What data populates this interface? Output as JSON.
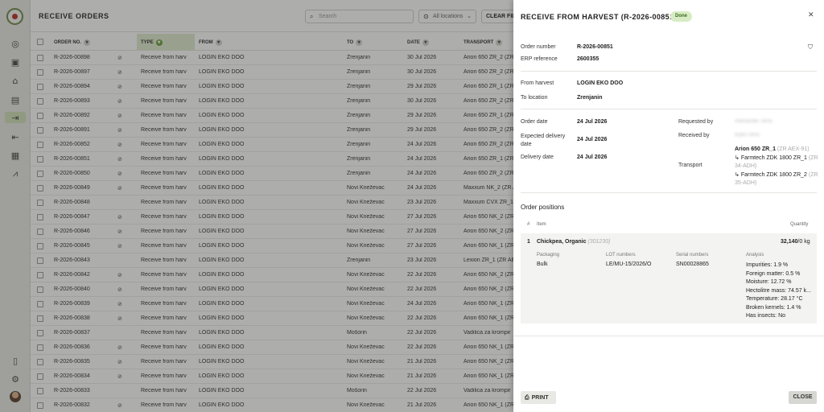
{
  "sidebar": {
    "icons": [
      "logo-icon",
      "globe-icon",
      "document-icon",
      "warehouse-icon",
      "clipboard-icon",
      "receive-icon",
      "dispatch-icon",
      "buildings-icon",
      "chart-icon"
    ],
    "bottom_icons": [
      "book-icon",
      "gear-icon",
      "avatar"
    ]
  },
  "header": {
    "title": "RECEIVE ORDERS",
    "search_placeholder": "Search",
    "location_select": "All locations",
    "clear_filters": "CLEAR FILTERS"
  },
  "table": {
    "columns": [
      "ORDER NO.",
      "TYPE",
      "FROM",
      "TO",
      "DATE",
      "TRANSPORT"
    ],
    "rows": [
      {
        "no": "R-2026-00898",
        "icon": true,
        "type": "Receive from harv",
        "from": "LOGIN EKO DOO",
        "to": "Zrenjanin",
        "date": "30 Jul 2026",
        "transport": "Arion 650 ZR_2 (ZR"
      },
      {
        "no": "R-2026-00897",
        "icon": true,
        "type": "Receive from harv",
        "from": "LOGIN EKO DOO",
        "to": "Zrenjanin",
        "date": "30 Jul 2026",
        "transport": "Arion 650 ZR_2 (ZR"
      },
      {
        "no": "R-2026-00894",
        "icon": true,
        "type": "Receive from harv",
        "from": "LOGIN EKO DOO",
        "to": "Zrenjanin",
        "date": "29 Jul 2026",
        "transport": "Arion 650 ZR_1 (ZR"
      },
      {
        "no": "R-2026-00893",
        "icon": true,
        "type": "Receive from harv",
        "from": "LOGIN EKO DOO",
        "to": "Zrenjanin",
        "date": "30 Jul 2026",
        "transport": "Arion 650 ZR_2 (ZR"
      },
      {
        "no": "R-2026-00892",
        "icon": true,
        "type": "Receive from harv",
        "from": "LOGIN EKO DOO",
        "to": "Zrenjanin",
        "date": "29 Jul 2026",
        "transport": "Arion 650 ZR_1 (ZR"
      },
      {
        "no": "R-2026-00891",
        "icon": true,
        "type": "Receive from harv",
        "from": "LOGIN EKO DOO",
        "to": "Zrenjanin",
        "date": "29 Jul 2026",
        "transport": "Arion 650 ZR_2 (ZR"
      },
      {
        "no": "R-2026-00852",
        "icon": true,
        "type": "Receive from harv",
        "from": "LOGIN EKO DOO",
        "to": "Zrenjanin",
        "date": "24 Jul 2026",
        "transport": "Arion 650 ZR_2 (ZR"
      },
      {
        "no": "R-2026-00851",
        "icon": true,
        "type": "Receive from harv",
        "from": "LOGIN EKO DOO",
        "to": "Zrenjanin",
        "date": "24 Jul 2026",
        "transport": "Arion 650 ZR_1 (ZR"
      },
      {
        "no": "R-2026-00850",
        "icon": true,
        "type": "Receive from harv",
        "from": "LOGIN EKO DOO",
        "to": "Zrenjanin",
        "date": "24 Jul 2026",
        "transport": "Arion 650 ZR_2 (ZR"
      },
      {
        "no": "R-2026-00849",
        "icon": true,
        "type": "Receive from harv",
        "from": "LOGIN EKO DOO",
        "to": "Novi Kneževac",
        "date": "24 Jul 2026",
        "transport": "Maxxum NK_2 (ZR A"
      },
      {
        "no": "R-2026-00848",
        "icon": false,
        "type": "Receive from harv",
        "from": "LOGIN EKO DOO",
        "to": "Novi Kneževac",
        "date": "23 Jul 2026",
        "transport": "Maxxum CVX ZR_1 ("
      },
      {
        "no": "R-2026-00847",
        "icon": true,
        "type": "Receive from harv",
        "from": "LOGIN EKO DOO",
        "to": "Novi Kneževac",
        "date": "27 Jul 2026",
        "transport": "Arion 650 NK_2 (ZR"
      },
      {
        "no": "R-2026-00846",
        "icon": true,
        "type": "Receive from harv",
        "from": "LOGIN EKO DOO",
        "to": "Novi Kneževac",
        "date": "27 Jul 2026",
        "transport": "Arion 650 NK_2 (ZR"
      },
      {
        "no": "R-2026-00845",
        "icon": true,
        "type": "Receive from harv",
        "from": "LOGIN EKO DOO",
        "to": "Novi Kneževac",
        "date": "27 Jul 2026",
        "transport": "Arion 650 NK_1 (ZR"
      },
      {
        "no": "R-2026-00843",
        "icon": false,
        "type": "Receive from harv",
        "from": "LOGIN EKO DOO",
        "to": "Zrenjanin",
        "date": "23 Jul 2026",
        "transport": "Lexion ZR_1 (ZR AE"
      },
      {
        "no": "R-2026-00842",
        "icon": true,
        "type": "Receive from harv",
        "from": "LOGIN EKO DOO",
        "to": "Novi Kneževac",
        "date": "22 Jul 2026",
        "transport": "Arion 650 NK_2 (ZR"
      },
      {
        "no": "R-2026-00840",
        "icon": true,
        "type": "Receive from harv",
        "from": "LOGIN EKO DOO",
        "to": "Novi Kneževac",
        "date": "22 Jul 2026",
        "transport": "Arion 650 NK_2 (ZR"
      },
      {
        "no": "R-2026-00839",
        "icon": true,
        "type": "Receive from harv",
        "from": "LOGIN EKO DOO",
        "to": "Novi Kneževac",
        "date": "24 Jul 2026",
        "transport": "Arion 650 NK_1 (ZR"
      },
      {
        "no": "R-2026-00838",
        "icon": true,
        "type": "Receive from harv",
        "from": "LOGIN EKO DOO",
        "to": "Novi Kneževac",
        "date": "22 Jul 2026",
        "transport": "Arion 650 NK_1 (ZR"
      },
      {
        "no": "R-2026-00837",
        "icon": false,
        "type": "Receive from harv",
        "from": "LOGIN EKO DOO",
        "to": "Mošorin",
        "date": "22 Jul 2026",
        "transport": "Vadilica za krompir"
      },
      {
        "no": "R-2026-00836",
        "icon": true,
        "type": "Receive from harv",
        "from": "LOGIN EKO DOO",
        "to": "Novi Kneževac",
        "date": "22 Jul 2026",
        "transport": "Arion 650 NK_1 (ZR"
      },
      {
        "no": "R-2026-00835",
        "icon": true,
        "type": "Receive from harv",
        "from": "LOGIN EKO DOO",
        "to": "Novi Kneževac",
        "date": "21 Jul 2026",
        "transport": "Arion 650 NK_2 (ZR"
      },
      {
        "no": "R-2026-00834",
        "icon": true,
        "type": "Receive from harv",
        "from": "LOGIN EKO DOO",
        "to": "Novi Kneževac",
        "date": "21 Jul 2026",
        "transport": "Arion 650 NK_1 (ZR"
      },
      {
        "no": "R-2026-00833",
        "icon": false,
        "type": "Receive from harv",
        "from": "LOGIN EKO DOO",
        "to": "Mošorin",
        "date": "22 Jul 2026",
        "transport": "Vadilica za krompir"
      },
      {
        "no": "R-2026-00832",
        "icon": true,
        "type": "Receive from harv",
        "from": "LOGIN EKO DOO",
        "to": "Novi Kneževac",
        "date": "21 Jul 2026",
        "transport": "Arion 650 NK_1 (ZR"
      }
    ]
  },
  "panel": {
    "title": "RECEIVE FROM HARVEST (R-2026-00851)",
    "status": "Done",
    "order_number_label": "Order number",
    "order_number": "R-2026-00851",
    "erp_label": "ERP reference",
    "erp": "2600355",
    "from_label": "From harvest",
    "from": "LOGIN EKO DOO",
    "to_label": "To location",
    "to": "Zrenjanin",
    "order_date_label": "Order date",
    "order_date": "24 Jul 2026",
    "expected_label": "Expected delivery date",
    "expected": "24 Jul 2026",
    "delivery_label": "Delivery date",
    "delivery": "24 Jul 2026",
    "requested_label": "Requested by",
    "requested": "Aleksandar Terna",
    "received_label": "Received by",
    "received": "Bojko Venić",
    "transport_label": "Transport",
    "transport_main": "Arion 650 ZR_1",
    "transport_main_reg": "(ZR AEX-91)",
    "transport_sub1": "Farmtech ZDK 1800 ZR_1",
    "transport_sub1_reg": "(ZR 34-ADH)",
    "transport_sub2": "Farmtech ZDK 1800 ZR_2",
    "transport_sub2_reg": "(ZR 35-ADH)",
    "positions_title": "Order positions",
    "col_hash": "#",
    "col_item": "Item",
    "col_qty": "Quantity",
    "position": {
      "index": "1",
      "name": "Chickpea, Organic",
      "code": "(301230)",
      "qty": "32,140",
      "qty_rest": "/0 kg",
      "packaging_label": "Packaging",
      "packaging": "Bulk",
      "lot_label": "LOT numbers",
      "lot": "LE/MU-15/2026/O",
      "serial_label": "Serial numbers",
      "serial": "SN00028865",
      "analysis_label": "Analysis",
      "analysis": [
        "Impurities: 1.9 %",
        "Foreign matter: 0.5 %",
        "Moisture: 12.72 %",
        "Hectolitre mass: 74.57 k...",
        "Temperature: 28.17 °C",
        "Broken kernels: 1.4 %",
        "Has insects: No"
      ]
    },
    "print_label": "PRINT",
    "close_label": "CLOSE"
  }
}
